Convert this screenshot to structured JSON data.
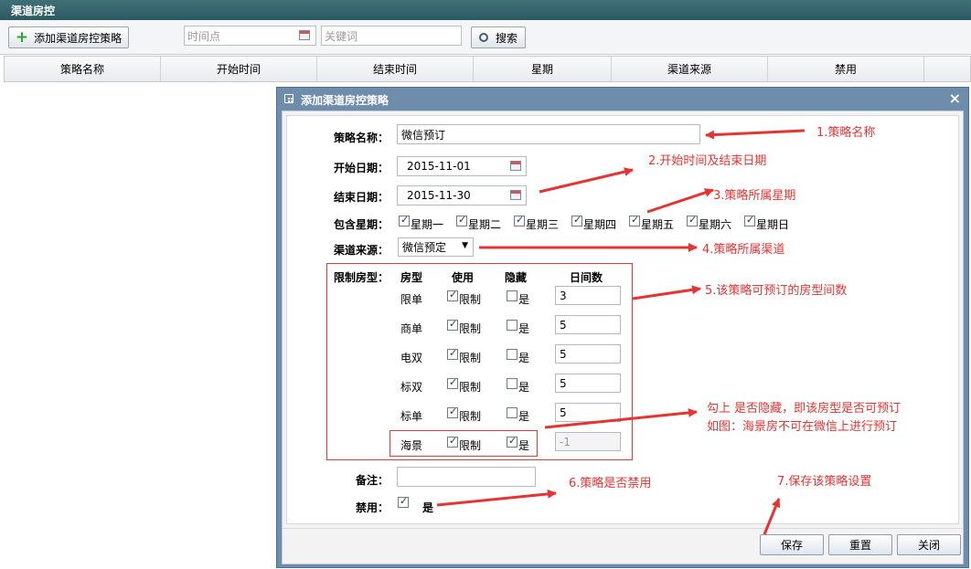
{
  "app": {
    "title": "渠道房控"
  },
  "toolbar": {
    "add_label": "添加渠道房控策略",
    "time_placeholder": "时间点",
    "keyword_placeholder": "关键词",
    "search_label": "搜索"
  },
  "grid": {
    "columns": [
      "策略名称",
      "开始时间",
      "结束时间",
      "星期",
      "渠道来源",
      "禁用"
    ]
  },
  "dialog": {
    "title": "添加渠道房控策略",
    "close": "×",
    "name_label": "策略名称：",
    "name_value": "微信预订",
    "start_label": "开始日期：",
    "start_value": "2015-11-01",
    "end_label": "结束日期：",
    "end_value": "2015-11-30",
    "week_label": "包含星期：",
    "weekdays": [
      "星期一",
      "星期二",
      "星期三",
      "星期四",
      "星期五",
      "星期六",
      "星期日"
    ],
    "channel_label": "渠道来源：",
    "channel_value": "微信预定",
    "limit_label": "限制房型：",
    "limit_headers": {
      "type": "房型",
      "use": "使用",
      "hide": "隐藏",
      "count": "日间数"
    },
    "rooms": [
      {
        "type": "限单",
        "use": "限制",
        "hide": "是",
        "count": "3",
        "use_checked": true,
        "hide_checked": false
      },
      {
        "type": "商单",
        "use": "限制",
        "hide": "是",
        "count": "5",
        "use_checked": true,
        "hide_checked": false
      },
      {
        "type": "电双",
        "use": "限制",
        "hide": "是",
        "count": "5",
        "use_checked": true,
        "hide_checked": false
      },
      {
        "type": "标双",
        "use": "限制",
        "hide": "是",
        "count": "5",
        "use_checked": true,
        "hide_checked": false
      },
      {
        "type": "标单",
        "use": "限制",
        "hide": "是",
        "count": "5",
        "use_checked": true,
        "hide_checked": false
      },
      {
        "type": "海景",
        "use": "限制",
        "hide": "是",
        "count": "-1",
        "use_checked": true,
        "hide_checked": true
      }
    ],
    "remark_label": "备注：",
    "remark_value": "",
    "disable_label": "禁用：",
    "disable_text": "是",
    "save": "保存",
    "reset": "重置",
    "close_btn": "关闭"
  },
  "annotations": {
    "a1": "1.策略名称",
    "a2": "2.开始时间及结束日期",
    "a3": "3.策略所属星期",
    "a4": "4.策略所属渠道",
    "a5": "5.该策略可预订的房型间数",
    "a_hide_1": "勾上 是否隐藏，即该房型是否可预订",
    "a_hide_2": "如图：海景房不可在微信上进行预订",
    "a6": "6.策略是否禁用",
    "a7": "7.保存该策略设置"
  },
  "colors": {
    "annotation": "#e43434",
    "dialog_frame": "#6e8cab",
    "titlebar": "#2d5a62"
  }
}
